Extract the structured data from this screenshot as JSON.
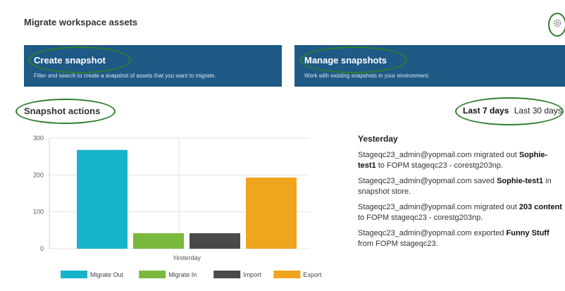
{
  "header": {
    "title": "Migrate workspace assets",
    "settings_icon": "gear-icon"
  },
  "cards": {
    "create": {
      "title": "Create snapshot",
      "description": "Filter and search to create a snapshot of assets that you want to migrate."
    },
    "manage": {
      "title": "Manage snapshots",
      "description": "Work with existing snapshots in your environment."
    }
  },
  "actions": {
    "title": "Snapshot actions"
  },
  "range": {
    "active": "Last 7 days",
    "inactive": "Last 30 days"
  },
  "chart_data": {
    "type": "bar",
    "categories": [
      "Yesterday"
    ],
    "series": [
      {
        "name": "Migrate Out",
        "values": [
          268
        ],
        "color": "#17b4c9"
      },
      {
        "name": "Migrate In",
        "values": [
          42
        ],
        "color": "#7ab83e"
      },
      {
        "name": "Import",
        "values": [
          42
        ],
        "color": "#4a4a4a"
      },
      {
        "name": "Export",
        "values": [
          193
        ],
        "color": "#f0a51e"
      }
    ],
    "ylim": [
      0,
      300
    ],
    "yticks": [
      "300",
      "200",
      "100",
      "0"
    ],
    "xlabel": "Yesterday",
    "legend_position": "bottom",
    "grid": true
  },
  "activity": {
    "heading": "Yesterday",
    "items": [
      {
        "pre": "Stageqc23_admin@yopmail.com migrated out ",
        "bold": "Sophie-test1",
        "post": " to FOPM stageqc23 - corestg203np."
      },
      {
        "pre": "Stageqc23_admin@yopmail.com saved ",
        "bold": "Sophie-test1",
        "post": " in snapshot store."
      },
      {
        "pre": "Stageqc23_admin@yopmail.com migrated out ",
        "bold": "203 content",
        "post": " to FOPM stageqc23 - corestg203np."
      },
      {
        "pre": "Stageqc23_admin@yopmail.com exported ",
        "bold": "Funny Stuff",
        "post": " from FOPM stageqc23."
      }
    ]
  }
}
